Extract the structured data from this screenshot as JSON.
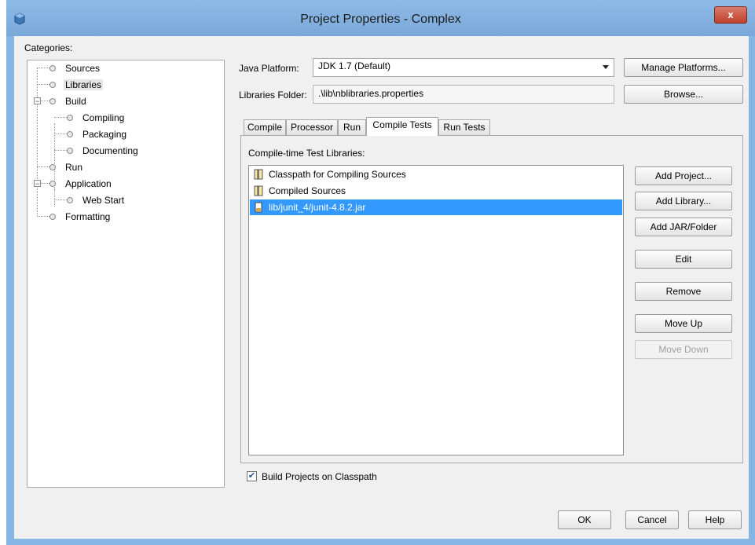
{
  "window": {
    "title": "Project Properties - Complex",
    "close_label": "x"
  },
  "categories": {
    "label": "Categories:",
    "items": [
      {
        "label": "Sources"
      },
      {
        "label": "Libraries",
        "selected": true
      },
      {
        "label": "Build",
        "expanded": true
      },
      {
        "label": "Compiling"
      },
      {
        "label": "Packaging"
      },
      {
        "label": "Documenting"
      },
      {
        "label": "Run"
      },
      {
        "label": "Application",
        "expanded": true
      },
      {
        "label": "Web Start"
      },
      {
        "label": "Formatting"
      }
    ]
  },
  "platform": {
    "label": "Java Platform:",
    "value": "JDK 1.7 (Default)",
    "manage_label": "Manage Platforms..."
  },
  "libraries_folder": {
    "label": "Libraries Folder:",
    "value": ".\\lib\\nblibraries.properties",
    "browse_label": "Browse..."
  },
  "tabs": [
    {
      "label": "Compile"
    },
    {
      "label": "Processor"
    },
    {
      "label": "Run"
    },
    {
      "label": "Compile Tests",
      "active": true
    },
    {
      "label": "Run Tests"
    }
  ],
  "panel": {
    "list_label": "Compile-time Test Libraries:",
    "items": [
      {
        "label": "Classpath for Compiling Sources",
        "icon": "library-icon"
      },
      {
        "label": "Compiled Sources",
        "icon": "library-icon"
      },
      {
        "label": "lib/junit_4/junit-4.8.2.jar",
        "icon": "jar-icon",
        "selected": true
      }
    ],
    "buttons": {
      "add_project": "Add Project...",
      "add_library": "Add Library...",
      "add_jar": "Add JAR/Folder",
      "edit": "Edit",
      "remove": "Remove",
      "move_up": "Move Up",
      "move_down": "Move Down"
    }
  },
  "build_on_classpath": {
    "label": "Build Projects on Classpath",
    "checked": true
  },
  "footer": {
    "ok": "OK",
    "cancel": "Cancel",
    "help": "Help"
  },
  "colors": {
    "selection": "#3399ff",
    "titlebar": "#88b6e4",
    "close": "#c7432f"
  }
}
